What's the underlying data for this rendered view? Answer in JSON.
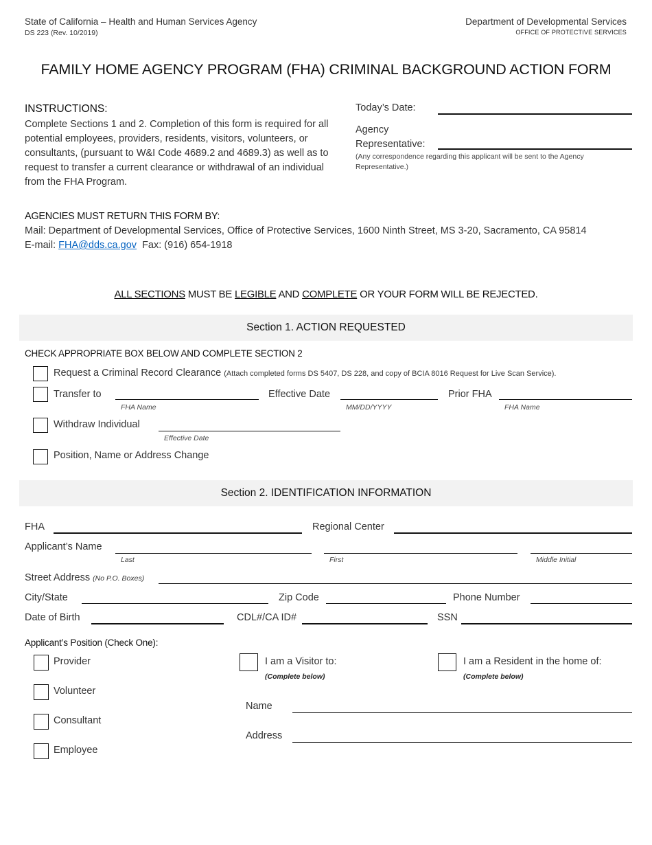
{
  "header": {
    "agency": "State of California – Health and Human Services Agency",
    "form_id": "DS 223 (Rev. 10/2019)",
    "department": "Department of Developmental Services",
    "office": "OFFICE OF PROTECTIVE SERVICES"
  },
  "title": "FAMILY HOME AGENCY PROGRAM (FHA) CRIMINAL BACKGROUND ACTION FORM",
  "instructions": {
    "heading": "INSTRUCTIONS:",
    "body": "Complete Sections 1 and 2.  Completion of this form is required for all potential employees, providers, residents, visitors, volunteers, or consultants, (pursuant to W&I Code 4689.2 and 4689.3) as well as to request to transfer a current clearance or withdrawal of an individual from the FHA Program."
  },
  "top_fields": {
    "todays_date_label": "Today’s Date:",
    "todays_date_value": "",
    "agency_rep_label_1": "Agency",
    "agency_rep_label_2": "Representative:",
    "agency_rep_value": "",
    "agency_rep_note": "(Any correspondence regarding this applicant will be sent to the Agency Representative.)"
  },
  "return_info": {
    "heading": "AGENCIES MUST RETURN THIS FORM BY:",
    "mail": "Mail: Department of Developmental Services, Office of Protective Services, 1600 Ninth Street, MS 3-20, Sacramento, CA 95814",
    "email_label": "E-mail: ",
    "email": "FHA@dds.ca.gov",
    "fax": "Fax: (916) 654-1918",
    "link_color": "#0563c1"
  },
  "warning": {
    "part1": "ALL SECTIONS",
    "part2": " MUST BE ",
    "part3": "LEGIBLE",
    "part4": " AND ",
    "part5": "COMPLETE",
    "part6": " OR YOUR FORM WILL BE REJECTED."
  },
  "section1": {
    "title": "Section 1.  ACTION REQUESTED",
    "instruction": "CHECK APPROPRIATE BOX BELOW AND COMPLETE SECTION 2",
    "request_label": "Request a Criminal Record Clearance ",
    "request_note": "(Attach completed forms DS 5407, DS 228, and copy of BCIA 8016 Request for Live Scan Service).",
    "transfer_label": "Transfer to",
    "transfer_hint": "FHA Name",
    "effective_date_label": "Effective Date",
    "effective_date_hint": "MM/DD/YYYY",
    "prior_fha_label": "Prior FHA",
    "prior_fha_hint": "FHA Name",
    "withdraw_label": "Withdraw Individual",
    "withdraw_hint": "Effective Date",
    "change_label": "Position, Name or Address Change"
  },
  "section2": {
    "title": "Section 2.  IDENTIFICATION INFORMATION",
    "fha_label": "FHA",
    "regional_center_label": "Regional Center",
    "applicant_name_label": "Applicant’s Name",
    "last_hint": "Last",
    "first_hint": "First",
    "middle_hint": "Middle Initial",
    "street_label": "Street Address ",
    "street_note": "(No P.O. Boxes)",
    "city_label": "City/State",
    "zip_label": "Zip Code",
    "phone_label": "Phone Number",
    "dob_label": "Date of Birth",
    "cdl_label": "CDL#/CA ID#",
    "ssn_label": "SSN",
    "position_heading": "Applicant’s Position (Check One):",
    "positions": [
      "Provider",
      "Volunteer",
      "Consultant",
      "Employee"
    ],
    "visitor_label": "I am a Visitor to:",
    "resident_label": "I am a Resident in the home of:",
    "complete_below": "(Complete below)",
    "name_label": "Name",
    "address_label": "Address"
  },
  "colors": {
    "section_bar": "#f2f2f2"
  }
}
